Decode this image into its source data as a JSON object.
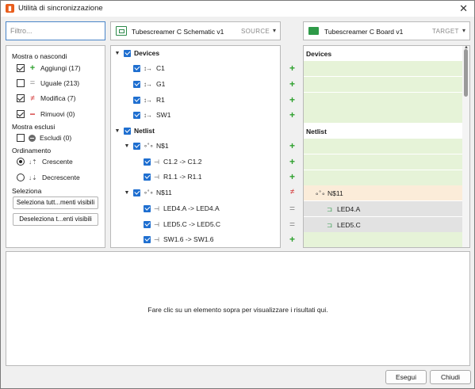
{
  "window": {
    "title": "Utilità di sincronizzazione",
    "close": "✕"
  },
  "filter": {
    "placeholder": "Filtro..."
  },
  "left": {
    "show_hide": "Mostra o nascondi",
    "add": "Aggiungi (17)",
    "same": "Uguale (213)",
    "modify": "Modifica (7)",
    "remove": "Rimuovi (0)",
    "show_excluded": "Mostra esclusi",
    "exclude": "Escludi (0)",
    "sort": "Ordinamento",
    "asc": "Crescente",
    "desc": "Decrescente",
    "select": "Seleziona",
    "select_all_btn": "Seleziona tutt...menti visibili",
    "deselect_all_btn": "Deseleziona t...enti visibili"
  },
  "source": {
    "name": "Tubescreamer C Schematic v1",
    "tag": "SOURCE"
  },
  "target": {
    "name": "Tubescreamer C Board v1",
    "tag": "TARGET"
  },
  "tree": {
    "devices": "Devices",
    "c1": "C1",
    "g1": "G1",
    "r1": "R1",
    "sw1": "SW1",
    "netlist": "Netlist",
    "n1": "N$1",
    "c1_2": "C1.2 -> C1.2",
    "r1_1": "R1.1 -> R1.1",
    "n11": "N$11",
    "led4a": "LED4.A -> LED4.A",
    "led5c": "LED5.C -> LED5.C",
    "sw1_6": "SW1.6 -> SW1.6"
  },
  "target_tree": {
    "devices": "Devices",
    "netlist": "Netlist",
    "n11": "N$11",
    "led4a": "LED4.A",
    "led5c": "LED5.C"
  },
  "results": {
    "message": "Fare clic su un elemento sopra per visualizzare i risultati qui."
  },
  "buttons": {
    "run": "Esegui",
    "close": "Chiudi"
  }
}
